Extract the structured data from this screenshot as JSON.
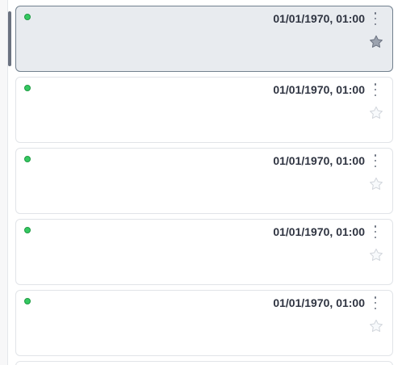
{
  "cards": [
    {
      "timestamp": "01/01/1970, 01:00",
      "status_color": "#35c861",
      "starred": false,
      "selected": true
    },
    {
      "timestamp": "01/01/1970, 01:00",
      "status_color": "#35c861",
      "starred": false,
      "selected": false
    },
    {
      "timestamp": "01/01/1970, 01:00",
      "status_color": "#35c861",
      "starred": false,
      "selected": false
    },
    {
      "timestamp": "01/01/1970, 01:00",
      "status_color": "#35c861",
      "starred": false,
      "selected": false
    },
    {
      "timestamp": "01/01/1970, 01:00",
      "status_color": "#35c861",
      "starred": false,
      "selected": false
    }
  ],
  "icons": {
    "menu": "kebab-menu-icon",
    "star": "star-icon"
  },
  "colors": {
    "selected_bg": "#e8ebef",
    "selected_border": "#72808e",
    "status_online": "#35c861"
  }
}
